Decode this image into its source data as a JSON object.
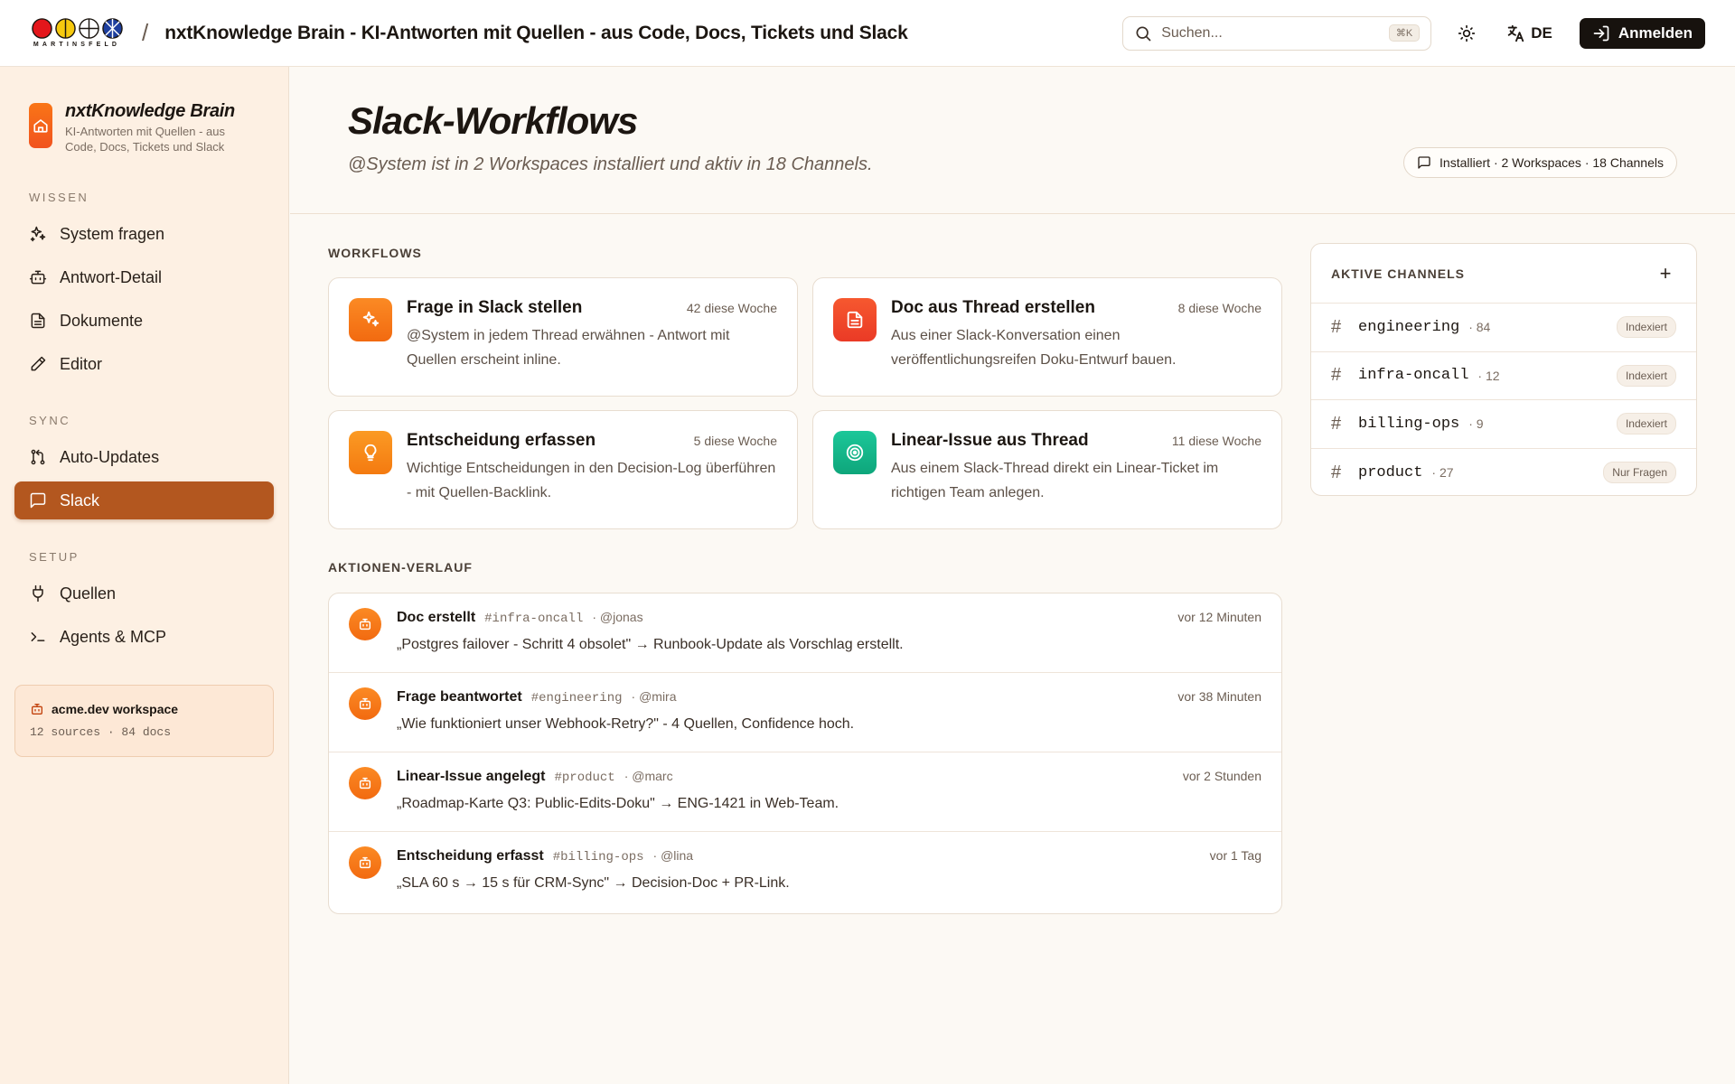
{
  "header": {
    "logo_word": "MARTINSFELD",
    "title": "nxtKnowledge Brain - KI-Antworten mit Quellen - aus Code, Docs, Tickets und Slack",
    "search_placeholder": "Suchen...",
    "search_shortcut": "⌘K",
    "language": "DE",
    "login_label": "Anmelden"
  },
  "sidebar": {
    "brand_title": "nxtKnowledge Brain",
    "brand_subtitle": "KI-Antworten mit Quellen - aus Code, Docs, Tickets und Slack",
    "sections": [
      {
        "label": "WISSEN",
        "items": [
          {
            "label": "System fragen",
            "icon": "sparkles-icon"
          },
          {
            "label": "Antwort-Detail",
            "icon": "bot-icon"
          },
          {
            "label": "Dokumente",
            "icon": "document-icon"
          },
          {
            "label": "Editor",
            "icon": "pencil-icon"
          }
        ]
      },
      {
        "label": "SYNC",
        "items": [
          {
            "label": "Auto-Updates",
            "icon": "git-pull-icon"
          },
          {
            "label": "Slack",
            "icon": "message-square-icon",
            "active": true
          }
        ]
      },
      {
        "label": "SETUP",
        "items": [
          {
            "label": "Quellen",
            "icon": "plug-icon"
          },
          {
            "label": "Agents & MCP",
            "icon": "terminal-icon"
          }
        ]
      }
    ],
    "workspace": {
      "name": "acme.dev workspace",
      "meta": "12 sources · 84 docs"
    }
  },
  "page": {
    "title": "Slack-Workflows",
    "subtitle": "@System ist in 2 Workspaces installiert und aktiv in 18 Channels.",
    "status": "Installiert · 2 Workspaces · 18 Channels"
  },
  "workflows": {
    "label": "WORKFLOWS",
    "cards": [
      {
        "title": "Frage in Slack stellen",
        "count": "42 diese Woche",
        "desc": "@System in jedem Thread erwähnen - Antwort mit Quellen erscheint inline.",
        "icon": "sparkles-icon",
        "color": "#f97516"
      },
      {
        "title": "Doc aus Thread erstellen",
        "count": "8 diese Woche",
        "desc": "Aus einer Slack-Konversation einen veröffentlichungsreifen Doku-Entwurf bauen.",
        "icon": "document-icon",
        "color": "#f0472a"
      },
      {
        "title": "Entscheidung erfassen",
        "count": "5 diese Woche",
        "desc": "Wichtige Entscheidungen in den Decision-Log überführen - mit Quellen-Backlink.",
        "icon": "lightbulb-icon",
        "color": "#fb8a14"
      },
      {
        "title": "Linear-Issue aus Thread",
        "count": "11 diese Woche",
        "desc": "Aus einem Slack-Thread direkt ein Linear-Ticket im richtigen Team anlegen.",
        "icon": "target-icon",
        "color": "#14b88a"
      }
    ]
  },
  "history": {
    "label": "AKTIONEN-VERLAUF",
    "items": [
      {
        "title": "Doc erstellt",
        "channel": "#infra-oncall",
        "user": "· @jonas",
        "time": "vor 12 Minuten",
        "text": "„Postgres failover - Schritt 4 obsolet\" → Runbook-Update als Vorschlag erstellt."
      },
      {
        "title": "Frage beantwortet",
        "channel": "#engineering",
        "user": "· @mira",
        "time": "vor 38 Minuten",
        "text": "„Wie funktioniert unser Webhook-Retry?\" - 4 Quellen, Confidence hoch."
      },
      {
        "title": "Linear-Issue angelegt",
        "channel": "#product",
        "user": "· @marc",
        "time": "vor 2 Stunden",
        "text": "„Roadmap-Karte Q3: Public-Edits-Doku\" → ENG-1421 in Web-Team."
      },
      {
        "title": "Entscheidung erfasst",
        "channel": "#billing-ops",
        "user": "· @lina",
        "time": "vor 1 Tag",
        "text": "„SLA 60 s → 15 s für CRM-Sync\" → Decision-Doc + PR-Link."
      }
    ]
  },
  "channels": {
    "label": "AKTIVE CHANNELS",
    "add_label": "+",
    "items": [
      {
        "name": "engineering",
        "count": "· 84",
        "status": "Indexiert"
      },
      {
        "name": "infra-oncall",
        "count": "· 12",
        "status": "Indexiert"
      },
      {
        "name": "billing-ops",
        "count": "· 9",
        "status": "Indexiert"
      },
      {
        "name": "product",
        "count": "· 27",
        "status": "Nur Fragen"
      }
    ]
  }
}
